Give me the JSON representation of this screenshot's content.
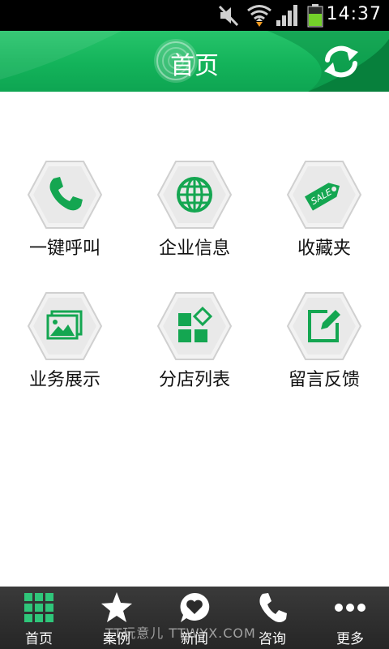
{
  "status_bar": {
    "time": "14:37",
    "icons": [
      "mute-icon",
      "wifi-icon",
      "signal-icon",
      "battery-icon"
    ]
  },
  "header": {
    "title": "首页",
    "refresh_icon": "refresh-icon",
    "colors": {
      "accent": "#13b35a",
      "dark": "#0b8f45"
    }
  },
  "grid": {
    "items": [
      {
        "label": "一键呼叫",
        "icon": "phone-icon"
      },
      {
        "label": "企业信息",
        "icon": "globe-icon"
      },
      {
        "label": "收藏夹",
        "icon": "sale-tag-icon"
      },
      {
        "label": "业务展示",
        "icon": "gallery-icon"
      },
      {
        "label": "分店列表",
        "icon": "shapes-icon"
      },
      {
        "label": "留言反馈",
        "icon": "edit-icon"
      }
    ]
  },
  "tabbar": {
    "tabs": [
      {
        "label": "首页",
        "icon": "grid-icon",
        "active": true
      },
      {
        "label": "案例",
        "icon": "star-icon"
      },
      {
        "label": "新闻",
        "icon": "heart-bubble-icon"
      },
      {
        "label": "咨询",
        "icon": "phone-icon"
      },
      {
        "label": "更多",
        "icon": "more-dots-icon"
      }
    ],
    "watermark": "TT玩意儿 TTWYX.COM"
  }
}
